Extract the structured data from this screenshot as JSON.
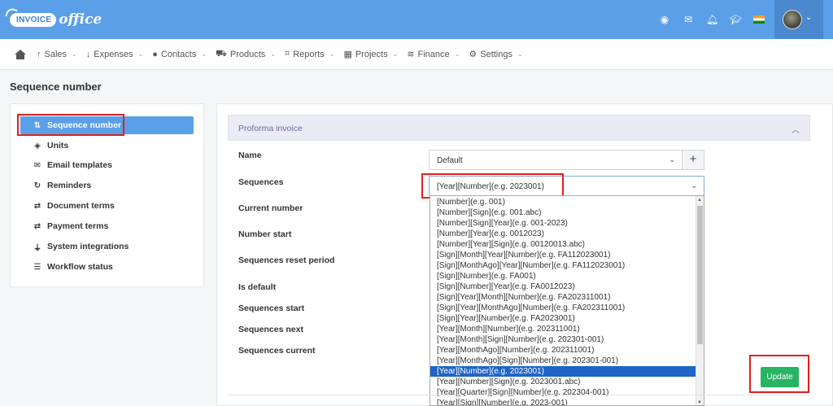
{
  "brand": {
    "badge": "INVOICE",
    "script": "office"
  },
  "topbar": {
    "icons": [
      "eye-icon",
      "envelope-icon",
      "bell-icon",
      "graduation-cap-icon",
      "india-flag-icon"
    ]
  },
  "nav": {
    "items": [
      {
        "label": "Sales",
        "icon": "↑"
      },
      {
        "label": "Expenses",
        "icon": "↓"
      },
      {
        "label": "Contacts",
        "icon": "👤"
      },
      {
        "label": "Products",
        "icon": "🛒"
      },
      {
        "label": "Reports",
        "icon": "📈"
      },
      {
        "label": "Projects",
        "icon": "▦"
      },
      {
        "label": "Finance",
        "icon": "≋"
      },
      {
        "label": "Settings",
        "icon": "⚙"
      }
    ]
  },
  "page": {
    "title": "Sequence number"
  },
  "sidebar": {
    "items": [
      {
        "label": "Sequence number",
        "icon": "⇅",
        "active": true
      },
      {
        "label": "Units",
        "icon": "◈"
      },
      {
        "label": "Email templates",
        "icon": "✉"
      },
      {
        "label": "Reminders",
        "icon": "↻"
      },
      {
        "label": "Document terms",
        "icon": "⇄"
      },
      {
        "label": "Payment terms",
        "icon": "⇄"
      },
      {
        "label": "System integrations",
        "icon": "⏚"
      },
      {
        "label": "Workflow status",
        "icon": "☰"
      }
    ]
  },
  "section": {
    "title": "Proforma invoice"
  },
  "form": {
    "labels": [
      "Name",
      "Sequences",
      "Current number",
      "Number start",
      "Sequences reset period",
      "Is default",
      "Sequences start",
      "Sequences next",
      "Sequences current"
    ],
    "name_value": "Default",
    "sequences_value": "[Year][Number](e.g. 2023001)"
  },
  "dropdown": {
    "options": [
      "[Number](e.g. 001)",
      "[Number][Sign](e.g. 001.abc)",
      "[Number][Sign][Year](e.g. 001-2023)",
      "[Number][Year](e.g. 0012023)",
      "[Number][Year][Sign](e.g. 00120013.abc)",
      "[Sign][Month][Year][Number](e.g. FA112023001)",
      "[Sign][MonthAgo][Year][Number](e.g. FA112023001)",
      "[Sign][Number](e.g. FA001)",
      "[Sign][Number][Year](e.g. FA0012023)",
      "[Sign][Year][Month][Number](e.g. FA202311001)",
      "[Sign][Year][MonthAgo][Number](e.g. FA202311001)",
      "[Sign][Year][Number](e.g. FA2023001)",
      "[Year][Month][Number](e.g. 202311001)",
      "[Year][Month][Sign][Number](e.g. 202301-001)",
      "[Year][MonthAgo][Number](e.g. 202311001)",
      "[Year][MonthAgo][Sign][Number](e.g. 202301-001)",
      "[Year][Number](e.g. 2023001)",
      "[Year][Number][Sign](e.g. 2023001.abc)",
      "[Year][Quarter][Sign][Number](e.g. 202304-001)",
      "[Year][Sign][Number](e.g. 2023-001)"
    ],
    "selected_index": 16
  },
  "actions": {
    "update_label": "Update"
  },
  "colors": {
    "brand": "#5b9fe8",
    "highlight": "#e0201d",
    "success": "#28b463",
    "selected": "#1f64c7"
  }
}
